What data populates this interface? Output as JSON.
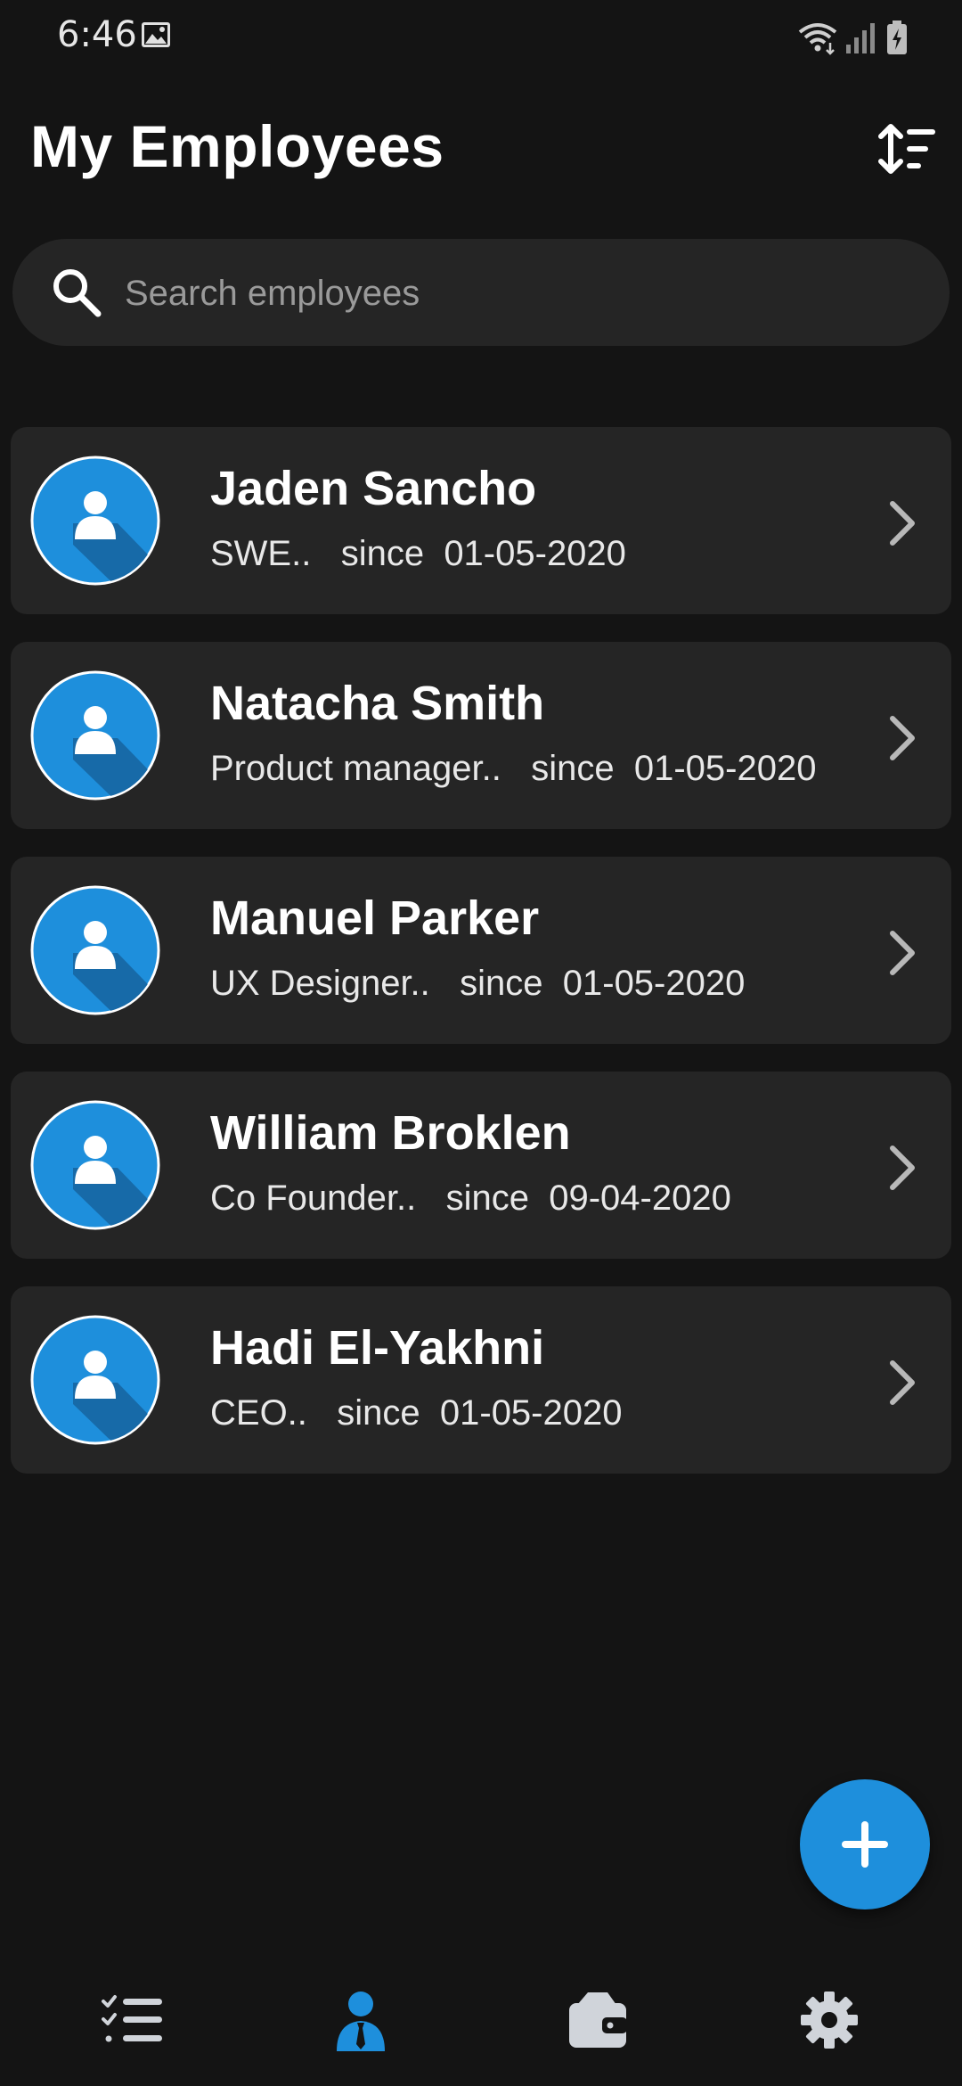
{
  "status_bar": {
    "time": "6:46",
    "icons": [
      "gallery-icon",
      "wifi-icon",
      "signal-icon",
      "battery-charging-icon"
    ]
  },
  "header": {
    "title": "My Employees",
    "sort_icon": "sort-icon"
  },
  "search": {
    "placeholder": "Search employees",
    "value": ""
  },
  "employees": [
    {
      "name": "Jaden Sancho",
      "role": "SWE..",
      "since_label": "since",
      "date": "01-05-2020"
    },
    {
      "name": "Natacha Smith",
      "role": "Product manager..",
      "since_label": "since",
      "date": "01-05-2020"
    },
    {
      "name": "Manuel Parker",
      "role": "UX Designer..",
      "since_label": "since",
      "date": "01-05-2020"
    },
    {
      "name": "William Broklen",
      "role": "Co Founder..",
      "since_label": "since",
      "date": "09-04-2020"
    },
    {
      "name": "Hadi El-Yakhni",
      "role": "CEO..",
      "since_label": "since",
      "date": "01-05-2020"
    }
  ],
  "fab": {
    "icon": "plus-icon"
  },
  "bottom_nav": {
    "items": [
      {
        "icon": "tasks-icon",
        "active": false
      },
      {
        "icon": "employees-icon",
        "active": true
      },
      {
        "icon": "wallet-icon",
        "active": false
      },
      {
        "icon": "settings-icon",
        "active": false
      }
    ]
  },
  "colors": {
    "background": "#141414",
    "card": "#252525",
    "accent": "#1e8fdc",
    "icon_inactive": "#d0d4da"
  }
}
